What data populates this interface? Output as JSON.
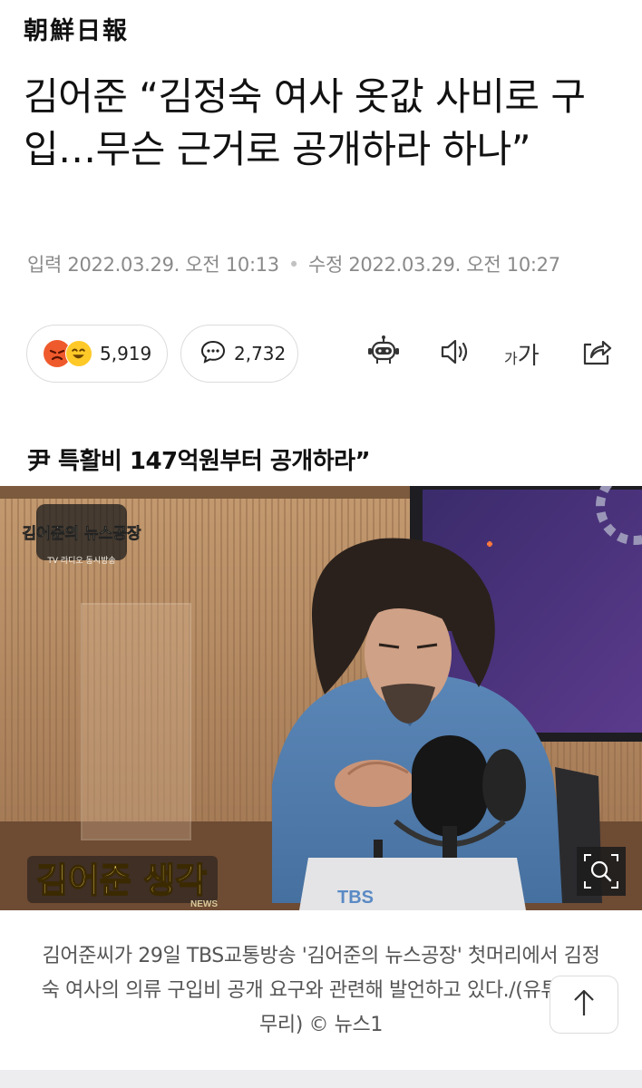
{
  "masthead": {
    "logo_text": "朝鮮日報"
  },
  "article": {
    "title": "김어준 “김정숙 여사 옷값 사비로 구입…무슨 근거로 공개하라 하나”",
    "published": "입력 2022.03.29. 오전 10:13",
    "modified": "수정 2022.03.29. 오전 10:27",
    "subheading": "尹 특활비 147억원부터 공개하라”",
    "photo": {
      "logo_text": "김어준의 뉴스공장",
      "logo_sub": "TV 라디오 동시방송",
      "chyron": "김어준 생각",
      "chyron_sub": "NEWS",
      "monitor_text": "TBS"
    },
    "caption": "김어준씨가 29일 TBS교통방송 '김어준의 뉴스공장' 첫머리에서 김정숙 여사의 의류 구입비 공개 요구와 관련해 발언하고 있다./(유튜브 갈무리) © 뉴스1"
  },
  "reactions": {
    "count": "5,919",
    "icons": [
      "angry-emoji-icon",
      "laugh-emoji-icon"
    ]
  },
  "comments": {
    "count": "2,732",
    "icon": "speech-bubble-icon"
  },
  "toolbar": {
    "summary_icon": "robot-icon",
    "audio_icon": "speaker-icon",
    "font_small": "가",
    "font_large": "가",
    "share_icon": "share-icon"
  },
  "colors": {
    "angry": "#ef5a2c",
    "laugh": "#ffc928",
    "meta_text": "#8a8a8a",
    "border": "#dcdcdc"
  }
}
